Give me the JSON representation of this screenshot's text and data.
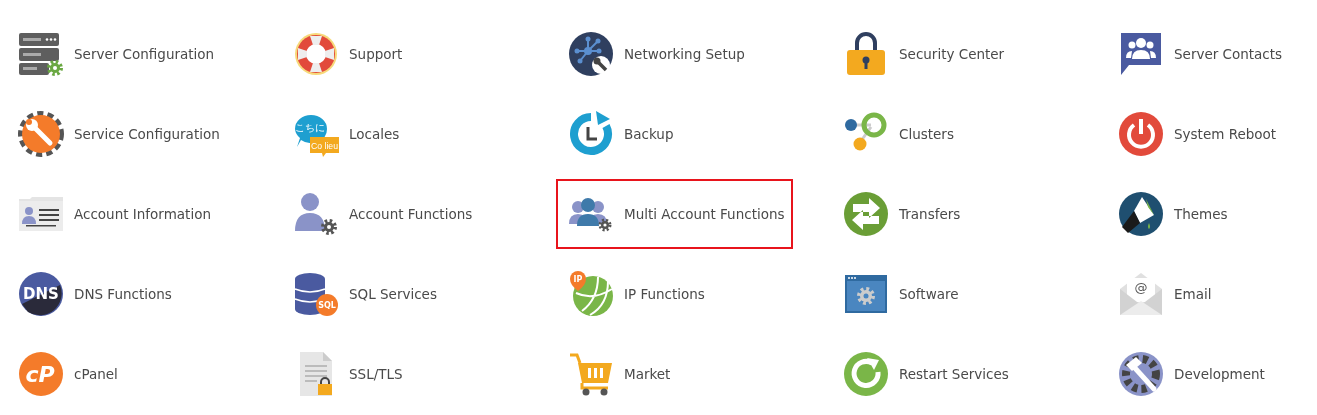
{
  "items": [
    {
      "label": "Server Configuration",
      "kind": "server-config",
      "highlighted": false
    },
    {
      "label": "Support",
      "kind": "support",
      "highlighted": false
    },
    {
      "label": "Networking Setup",
      "kind": "networking",
      "highlighted": false
    },
    {
      "label": "Security Center",
      "kind": "lock",
      "highlighted": false
    },
    {
      "label": "Server Contacts",
      "kind": "contacts",
      "highlighted": false
    },
    {
      "label": "Service Configuration",
      "kind": "service-config",
      "highlighted": false
    },
    {
      "label": "Locales",
      "kind": "locales",
      "icon_text": [
        "こちに",
        "Co lieu"
      ],
      "highlighted": false
    },
    {
      "label": "Backup",
      "kind": "backup",
      "highlighted": false
    },
    {
      "label": "Clusters",
      "kind": "clusters",
      "highlighted": false
    },
    {
      "label": "System Reboot",
      "kind": "reboot",
      "highlighted": false
    },
    {
      "label": "Account Information",
      "kind": "account-info",
      "highlighted": false
    },
    {
      "label": "Account Functions",
      "kind": "account-func",
      "highlighted": false
    },
    {
      "label": "Multi Account Functions",
      "kind": "multi-account",
      "highlighted": true
    },
    {
      "label": "Transfers",
      "kind": "transfers",
      "highlighted": false
    },
    {
      "label": "Themes",
      "kind": "themes",
      "highlighted": false
    },
    {
      "label": "DNS Functions",
      "kind": "dns",
      "icon_text": [
        "DNS"
      ],
      "highlighted": false
    },
    {
      "label": "SQL Services",
      "kind": "sql",
      "icon_text": [
        "SQL"
      ],
      "highlighted": false
    },
    {
      "label": "IP Functions",
      "kind": "ip",
      "icon_text": [
        "IP"
      ],
      "highlighted": false
    },
    {
      "label": "Software",
      "kind": "software",
      "highlighted": false
    },
    {
      "label": "Email",
      "kind": "email",
      "icon_text": [
        "@"
      ],
      "highlighted": false
    },
    {
      "label": "cPanel",
      "kind": "cpanel",
      "icon_text": [
        "cP"
      ],
      "highlighted": false
    },
    {
      "label": "SSL/TLS",
      "kind": "ssl",
      "highlighted": false
    },
    {
      "label": "Market",
      "kind": "market",
      "highlighted": false
    },
    {
      "label": "Restart Services",
      "kind": "restart",
      "highlighted": false
    },
    {
      "label": "Development",
      "kind": "development",
      "highlighted": false
    }
  ]
}
